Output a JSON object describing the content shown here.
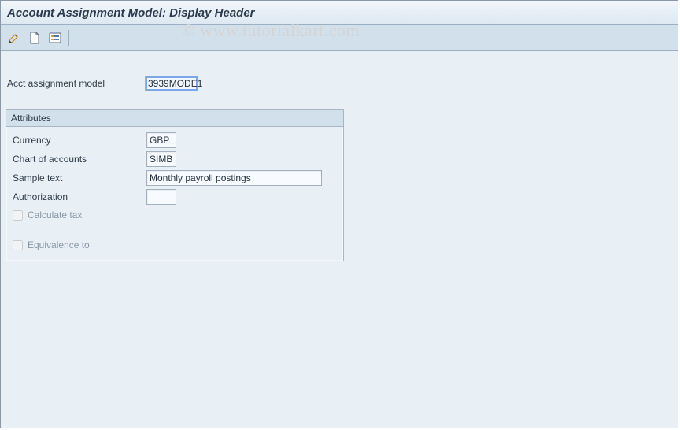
{
  "header": {
    "title": "Account Assignment Model: Display Header"
  },
  "toolbar": {
    "icons": {
      "change": "change-icon",
      "new": "new-page-icon",
      "overview": "overview-icon"
    }
  },
  "main": {
    "acct_assignment_model": {
      "label": "Acct assignment model",
      "value": "3939MODE1"
    }
  },
  "attributes": {
    "title": "Attributes",
    "currency": {
      "label": "Currency",
      "value": "GBP"
    },
    "chart_of_accounts": {
      "label": "Chart of accounts",
      "value": "SIMB"
    },
    "sample_text": {
      "label": "Sample text",
      "value": "Monthly payroll postings"
    },
    "authorization": {
      "label": "Authorization",
      "value": ""
    },
    "calculate_tax": {
      "label": "Calculate tax",
      "checked": false
    },
    "equivalence_to": {
      "label": "Equivalence to",
      "checked": false
    }
  },
  "watermark": {
    "text": "© www.tutorialkart.com"
  }
}
